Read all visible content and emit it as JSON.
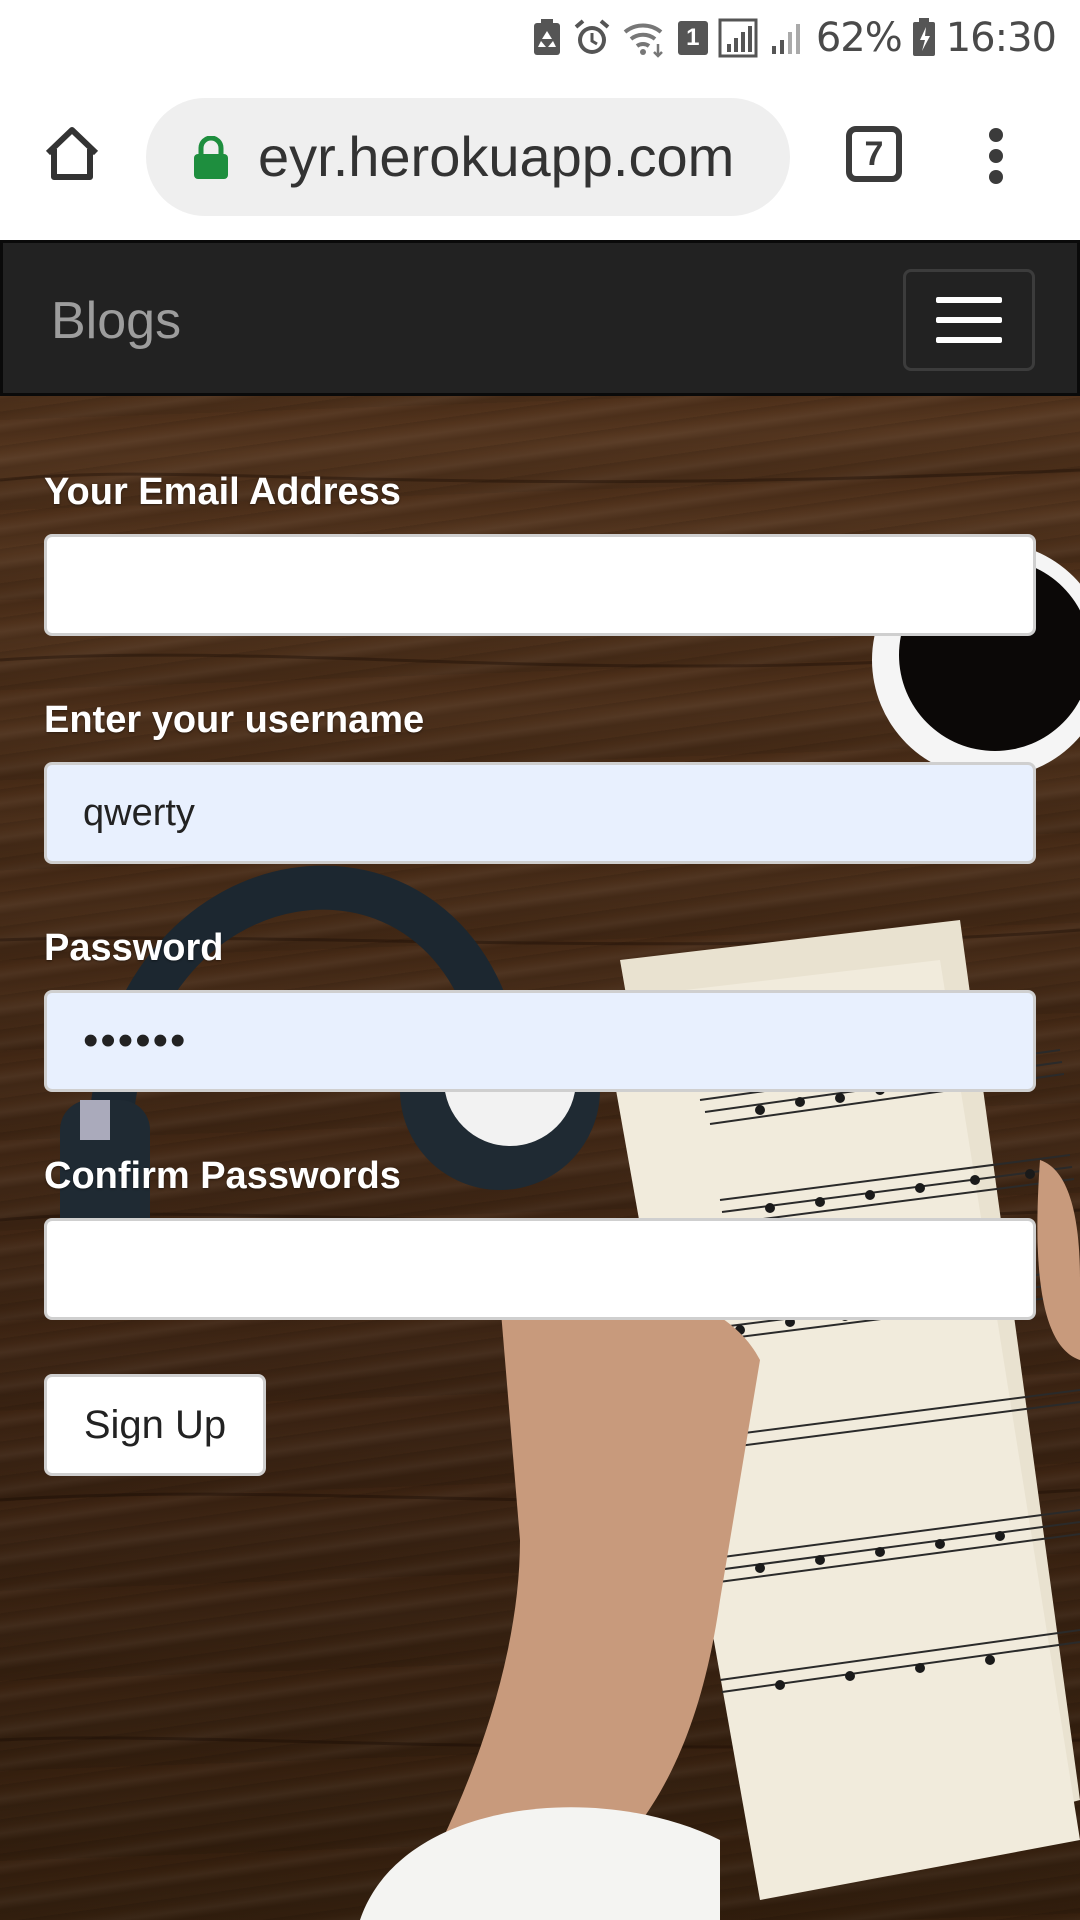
{
  "status_bar": {
    "battery": "62%",
    "time": "16:30",
    "sim_slot": "1",
    "icons": [
      "recycle-icon",
      "alarm-icon",
      "wifi-icon",
      "sim-badge",
      "signal-icon",
      "signal-weak-icon",
      "battery-icon"
    ]
  },
  "browser": {
    "url": "eyr.herokuapp.com",
    "tab_count": "7",
    "icons": [
      "home-icon",
      "lock-icon",
      "tabs-icon",
      "more-vert-icon"
    ],
    "lock_color": "#1e8e3e"
  },
  "navbar": {
    "brand": "Blogs",
    "toggler_icon": "hamburger-icon"
  },
  "form": {
    "email_label": "Your Email Address",
    "email_value": "",
    "username_label": "Enter your username",
    "username_value": "qwerty",
    "password_label": "Password",
    "password_value": "••••••",
    "confirm_label": "Confirm Passwords",
    "confirm_value": "",
    "submit_label": "Sign Up"
  },
  "colors": {
    "navbar_bg": "#222222",
    "brand_text": "#9d9d9d",
    "autofill_bg": "#e8f0fe"
  }
}
